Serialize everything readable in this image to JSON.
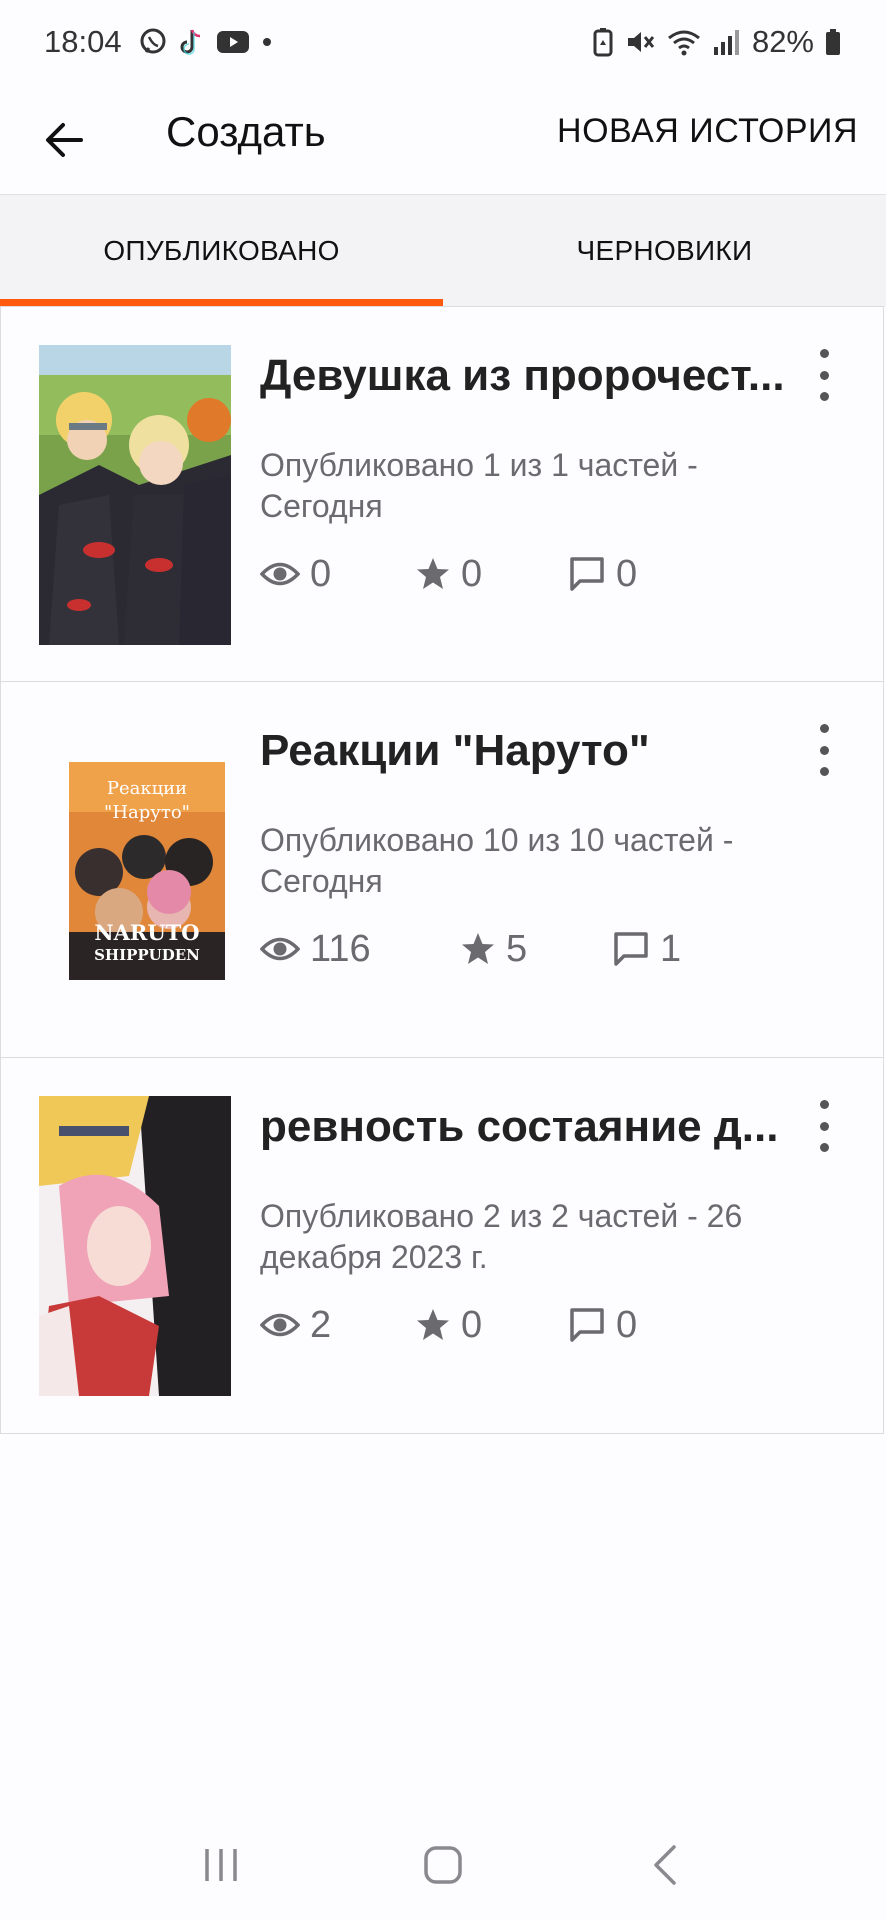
{
  "status_bar": {
    "time": "18:04",
    "left_icons": [
      "viber-icon",
      "tiktok-icon",
      "youtube-icon",
      "dot-icon"
    ],
    "right_icons": [
      "battery-saver-icon",
      "mute-icon",
      "wifi-icon",
      "signal-icon"
    ],
    "battery": "82%"
  },
  "app_bar": {
    "title": "Создать",
    "action_label": "НОВАЯ ИСТОРИЯ"
  },
  "tabs": [
    {
      "label": "ОПУБЛИКОВАНО",
      "active": true
    },
    {
      "label": "ЧЕРНОВИКИ",
      "active": false
    }
  ],
  "stories": [
    {
      "title": "Девушка из пророчест...",
      "meta": "Опубликовано 1 из 1 частей - Сегодня",
      "views": "0",
      "votes": "0",
      "comments": "0"
    },
    {
      "title": "Реакции \"Наруто\"",
      "meta": "Опубликовано 10 из 10 частей - Сегодня",
      "views": "116",
      "votes": "5",
      "comments": "1",
      "cover_text": {
        "line1": "Реакции",
        "line2": "\"Наруто\"",
        "logo1": "NARUTO",
        "logo2": "SHIPPUDEN"
      }
    },
    {
      "title": "ревность состаяние д...",
      "meta": "Опубликовано 2 из 2 частей - 26 декабря 2023 г.",
      "views": "2",
      "votes": "0",
      "comments": "0"
    }
  ],
  "colors": {
    "accent": "#ff5a0d",
    "muted_text": "#6b6b6f",
    "tab_bg": "#f3f2f4"
  }
}
